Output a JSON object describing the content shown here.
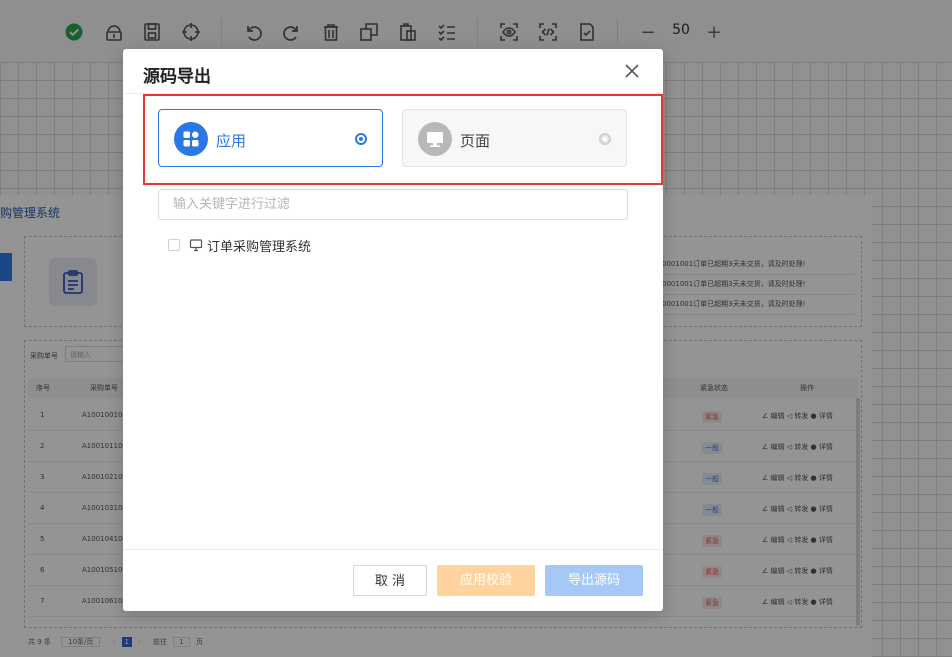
{
  "toolbar": {
    "icons": [
      "check-circle-icon",
      "lock-icon",
      "save-icon",
      "crosshair-icon",
      "undo-icon",
      "redo-icon",
      "delete-icon",
      "copy-icon",
      "paste-icon",
      "list-check-icon",
      "preview-icon",
      "code-icon",
      "check-doc-icon",
      "zoom-minus-icon",
      "zoom-plus-icon"
    ],
    "zoom_value": "50",
    "zoom_minus": "−",
    "zoom_plus": "+"
  },
  "background": {
    "app_title": "购管理系统",
    "messages": [
      "0001001订单已超期3天未交货，请及时处理!",
      "0001001订单已超期3天未交货，请及时处理!",
      "0001001订单已超期3天未交货，请及时处理!"
    ],
    "filter_label": "采购单号",
    "filter_placeholder": "请输入",
    "columns": [
      "序号",
      "采购单号",
      "紧急状态",
      "操作"
    ],
    "rows": [
      {
        "no": "1",
        "code": "A100100100",
        "status": "紧急",
        "kind": "urgent"
      },
      {
        "no": "2",
        "code": "A100101100",
        "status": "一般",
        "kind": "normal"
      },
      {
        "no": "3",
        "code": "A100102100",
        "status": "一般",
        "kind": "normal"
      },
      {
        "no": "4",
        "code": "A100103100",
        "status": "一般",
        "kind": "normal"
      },
      {
        "no": "5",
        "code": "A100104100",
        "status": "紧急",
        "kind": "urgent"
      },
      {
        "no": "6",
        "code": "A100105100",
        "status": "紧急",
        "kind": "urgent"
      },
      {
        "no": "7",
        "code": "A100106100",
        "status": "紧急",
        "kind": "urgent"
      }
    ],
    "ops": "∠ 编辑   ◁ 转发   ● 详情",
    "footer": {
      "total": "共 9 条",
      "page_size": "10条/页",
      "page": "1",
      "goto": "前往",
      "goto_value": "1",
      "page_unit": "页"
    }
  },
  "dialog": {
    "title": "源码导出",
    "options": [
      {
        "label": "应用",
        "icon": "app-grid-icon",
        "selected": true
      },
      {
        "label": "页面",
        "icon": "page-monitor-icon",
        "selected": false
      }
    ],
    "filter_placeholder": "输入关键字进行过滤",
    "tree_items": [
      {
        "label": "订单采购管理系统",
        "checked": false
      }
    ],
    "buttons": {
      "cancel": "取 消",
      "check": "应用校验",
      "export": "导出源码"
    }
  },
  "colors": {
    "primary": "#2b78e4",
    "warning_disabled": "#ffd39e",
    "primary_disabled": "#a5c8f6",
    "highlight": "#e53935",
    "success": "#2aa84a"
  }
}
